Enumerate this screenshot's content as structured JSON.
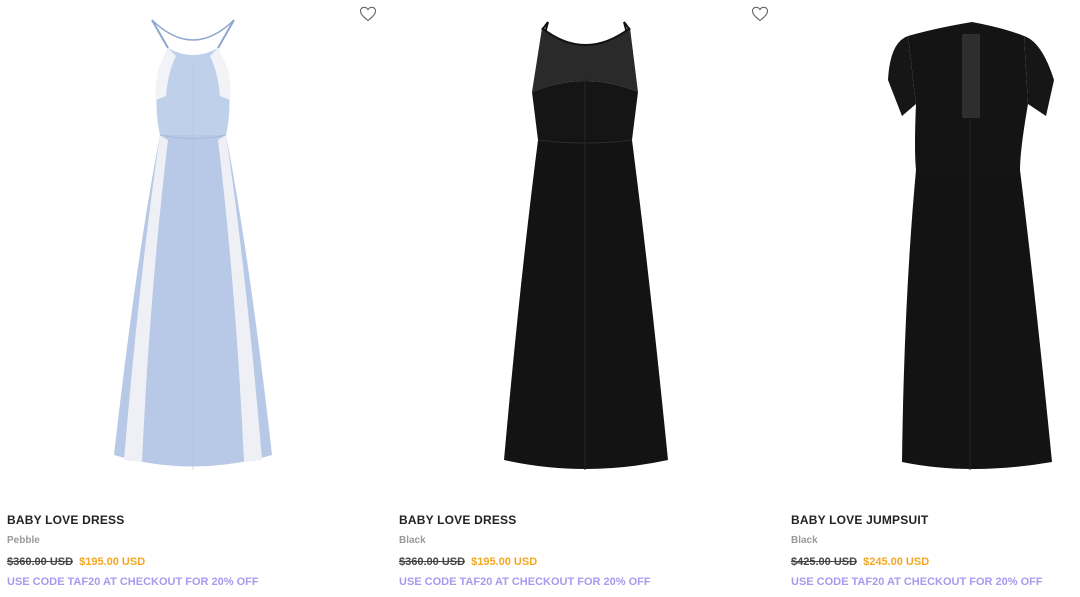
{
  "products": [
    {
      "name": "BABY LOVE DRESS",
      "variant": "Pebble",
      "old_price": "$360.00 USD",
      "new_price": "$195.00 USD",
      "promo": "USE CODE TAF20 AT CHECKOUT FOR 20% OFF",
      "image_desc": "light blue satin halter maxi dress with white lace panels"
    },
    {
      "name": "BABY LOVE DRESS",
      "variant": "Black",
      "old_price": "$360.00 USD",
      "new_price": "$195.00 USD",
      "promo": "USE CODE TAF20 AT CHECKOUT FOR 20% OFF",
      "image_desc": "black satin halter maxi dress with black lace yoke"
    },
    {
      "name": "BABY LOVE JUMPSUIT",
      "variant": "Black",
      "old_price": "$425.00 USD",
      "new_price": "$245.00 USD",
      "promo": "USE CODE TAF20 AT CHECKOUT FOR 20% OFF",
      "image_desc": "black short-sleeve lace-trim maxi garment"
    }
  ],
  "icons": {
    "wishlist": "heart-outline-icon"
  },
  "colors": {
    "old_price": "#444444",
    "sale_price": "#f5a623",
    "promo": "#a79af0",
    "variant": "#9a9a9a",
    "dress_blue": "#b9cbe6",
    "dress_black": "#141414"
  }
}
